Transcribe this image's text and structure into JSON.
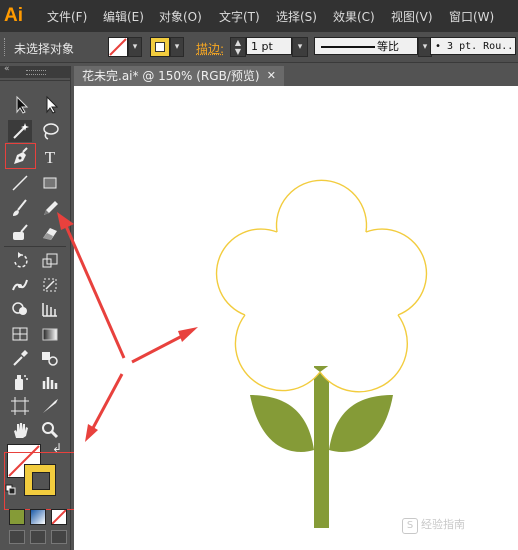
{
  "menubar": {
    "logo": "Ai",
    "items": [
      "文件(F)",
      "编辑(E)",
      "对象(O)",
      "文字(T)",
      "选择(S)",
      "效果(C)",
      "视图(V)",
      "窗口(W)"
    ]
  },
  "controlbar": {
    "selection_status": "未选择对象",
    "stroke_label": "描边:",
    "stroke_weight": "1 pt",
    "profile_label": "等比",
    "brush": "• 3 pt. Rou.."
  },
  "tab": {
    "title": "花未完.ai* @ 150% (RGB/预览)",
    "close": "✕"
  },
  "watermark": "经验指南",
  "colors": {
    "menubar_bg": "#323232",
    "panel_bg": "#535353",
    "stroke_yellow": "#f2cc3e",
    "leaf_green": "#859b37",
    "annotation_red": "#e8413d",
    "logo_orange": "#ff9a00"
  },
  "tools": [
    "selection-icon",
    "direct-selection-icon",
    "magic-wand-icon",
    "lasso-icon",
    "pen-icon",
    "type-icon",
    "line-segment-icon",
    "rectangle-icon",
    "paintbrush-icon",
    "pencil-icon",
    "blob-brush-icon",
    "eraser-icon",
    "rotate-icon",
    "scale-icon",
    "warp-icon",
    "free-transform-icon",
    "shape-builder-icon",
    "perspective-grid-icon",
    "mesh-icon",
    "gradient-icon",
    "eyedropper-icon",
    "blend-icon",
    "symbol-sprayer-icon",
    "column-graph-icon",
    "artboard-icon",
    "slice-icon",
    "hand-icon",
    "zoom-icon"
  ]
}
